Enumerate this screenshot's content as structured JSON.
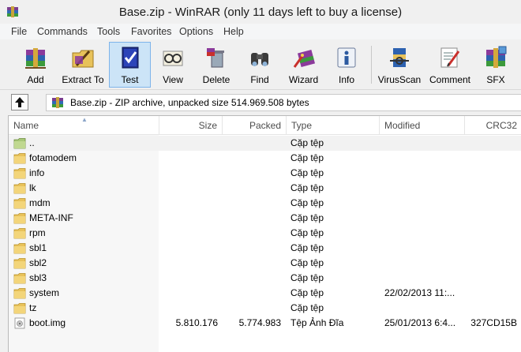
{
  "window": {
    "title": "Base.zip - WinRAR (only 11 days left to buy a license)"
  },
  "menu": [
    "File",
    "Commands",
    "Tools",
    "Favorites",
    "Options",
    "Help"
  ],
  "toolbar": {
    "add": "Add",
    "extract": "Extract To",
    "test": "Test",
    "view": "View",
    "delete": "Delete",
    "find": "Find",
    "wizard": "Wizard",
    "info": "Info",
    "virusscan": "VirusScan",
    "comment": "Comment",
    "sfx": "SFX"
  },
  "address": {
    "text": "Base.zip - ZIP archive, unpacked size 514.969.508 bytes"
  },
  "columns": {
    "name": "Name",
    "size": "Size",
    "packed": "Packed",
    "type": "Type",
    "modified": "Modified",
    "crc": "CRC32"
  },
  "files": [
    {
      "name": "..",
      "size": "",
      "packed": "",
      "type": "Cặp tệp",
      "modified": "",
      "crc": "",
      "icon": "folder-up-icon"
    },
    {
      "name": "fotamodem",
      "size": "",
      "packed": "",
      "type": "Cặp tệp",
      "modified": "",
      "crc": "",
      "icon": "folder-icon"
    },
    {
      "name": "info",
      "size": "",
      "packed": "",
      "type": "Cặp tệp",
      "modified": "",
      "crc": "",
      "icon": "folder-icon"
    },
    {
      "name": "lk",
      "size": "",
      "packed": "",
      "type": "Cặp tệp",
      "modified": "",
      "crc": "",
      "icon": "folder-icon"
    },
    {
      "name": "mdm",
      "size": "",
      "packed": "",
      "type": "Cặp tệp",
      "modified": "",
      "crc": "",
      "icon": "folder-icon"
    },
    {
      "name": "META-INF",
      "size": "",
      "packed": "",
      "type": "Cặp tệp",
      "modified": "",
      "crc": "",
      "icon": "folder-icon"
    },
    {
      "name": "rpm",
      "size": "",
      "packed": "",
      "type": "Cặp tệp",
      "modified": "",
      "crc": "",
      "icon": "folder-icon"
    },
    {
      "name": "sbl1",
      "size": "",
      "packed": "",
      "type": "Cặp tệp",
      "modified": "",
      "crc": "",
      "icon": "folder-icon"
    },
    {
      "name": "sbl2",
      "size": "",
      "packed": "",
      "type": "Cặp tệp",
      "modified": "",
      "crc": "",
      "icon": "folder-icon"
    },
    {
      "name": "sbl3",
      "size": "",
      "packed": "",
      "type": "Cặp tệp",
      "modified": "",
      "crc": "",
      "icon": "folder-icon"
    },
    {
      "name": "system",
      "size": "",
      "packed": "",
      "type": "Cặp tệp",
      "modified": "22/02/2013 11:...",
      "crc": "",
      "icon": "folder-icon"
    },
    {
      "name": "tz",
      "size": "",
      "packed": "",
      "type": "Cặp tệp",
      "modified": "",
      "crc": "",
      "icon": "folder-icon"
    },
    {
      "name": "boot.img",
      "size": "5.810.176",
      "packed": "5.774.983",
      "type": "Tệp Ảnh Đĩa",
      "modified": "25/01/2013 6:4...",
      "crc": "327CD15B",
      "icon": "disk-image-icon"
    }
  ]
}
